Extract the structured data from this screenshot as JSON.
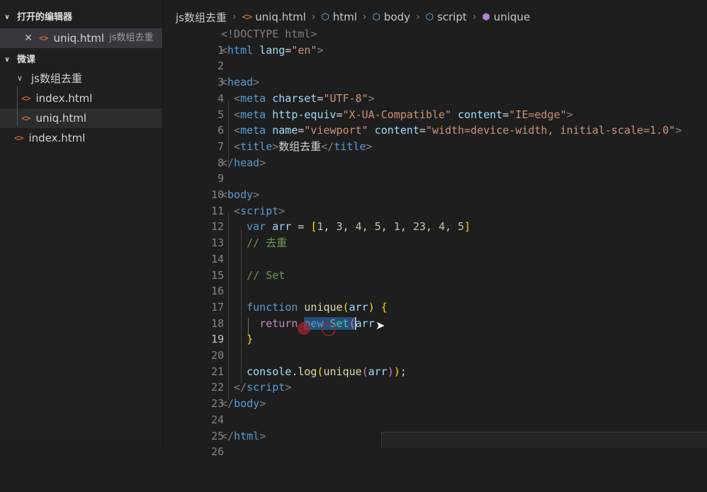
{
  "explorer": {
    "open_editors_title": "打开的编辑器",
    "open_editor_file": "uniq.html",
    "open_editor_desc": "js数组去重",
    "workspace_title": "微课",
    "folder": "js数组去重",
    "files": [
      "index.html",
      "uniq.html"
    ],
    "root_file": "index.html"
  },
  "breadcrumb": {
    "folder": "js数组去重",
    "file": "uniq.html",
    "items": [
      "html",
      "body",
      "script",
      "unique"
    ]
  },
  "editor": {
    "line_numbers": [
      "1",
      "2",
      "3",
      "4",
      "5",
      "6",
      "7",
      "8",
      "9",
      "10",
      "11",
      "12",
      "13",
      "14",
      "15",
      "16",
      "17",
      "18",
      "19",
      "20",
      "21",
      "22",
      "23",
      "24",
      "25",
      "26"
    ],
    "current_line": "19",
    "code": {
      "l1": "<!DOCTYPE html>",
      "l2_html": "html",
      "l2_lang": "lang",
      "l2_val": "\"en\"",
      "l4": "head",
      "l5_tag": "meta",
      "l5_attr": "charset",
      "l5_val": "\"UTF-8\"",
      "l6_tag": "meta",
      "l6_attr1": "http-equiv",
      "l6_val1": "\"X-UA-Compatible\"",
      "l6_attr2": "content",
      "l6_val2": "\"IE=edge\"",
      "l7_tag": "meta",
      "l7_attr1": "name",
      "l7_val1": "\"viewport\"",
      "l7_attr2": "content",
      "l7_val2": "\"width=device-width, initial-scale=1.0\"",
      "l8_tag": "title",
      "l8_text": "数组去重",
      "l9": "head",
      "l11": "body",
      "l12": "script",
      "l13_kw": "var",
      "l13_var": "arr",
      "l13_nums": [
        "1",
        "3",
        "4",
        "5",
        "1",
        "23",
        "4",
        "5"
      ],
      "l14": "// 去重",
      "l16": "// Set",
      "l18_kw": "function",
      "l18_fn": "unique",
      "l18_param": "arr",
      "l19_ret": "return",
      "l19_new": "new",
      "l19_cls": "Set",
      "l19_arg": "arr",
      "l22_obj": "console",
      "l22_fn": "log",
      "l22_inner": "unique",
      "l22_arg": "arr",
      "l23": "script",
      "l24": "body",
      "l26": "html"
    }
  },
  "bottom_panel": {
    "text": ""
  },
  "colors": {
    "background": "#1e1e1e",
    "sidebar": "#1f1f1f",
    "selection": "#264f78"
  }
}
